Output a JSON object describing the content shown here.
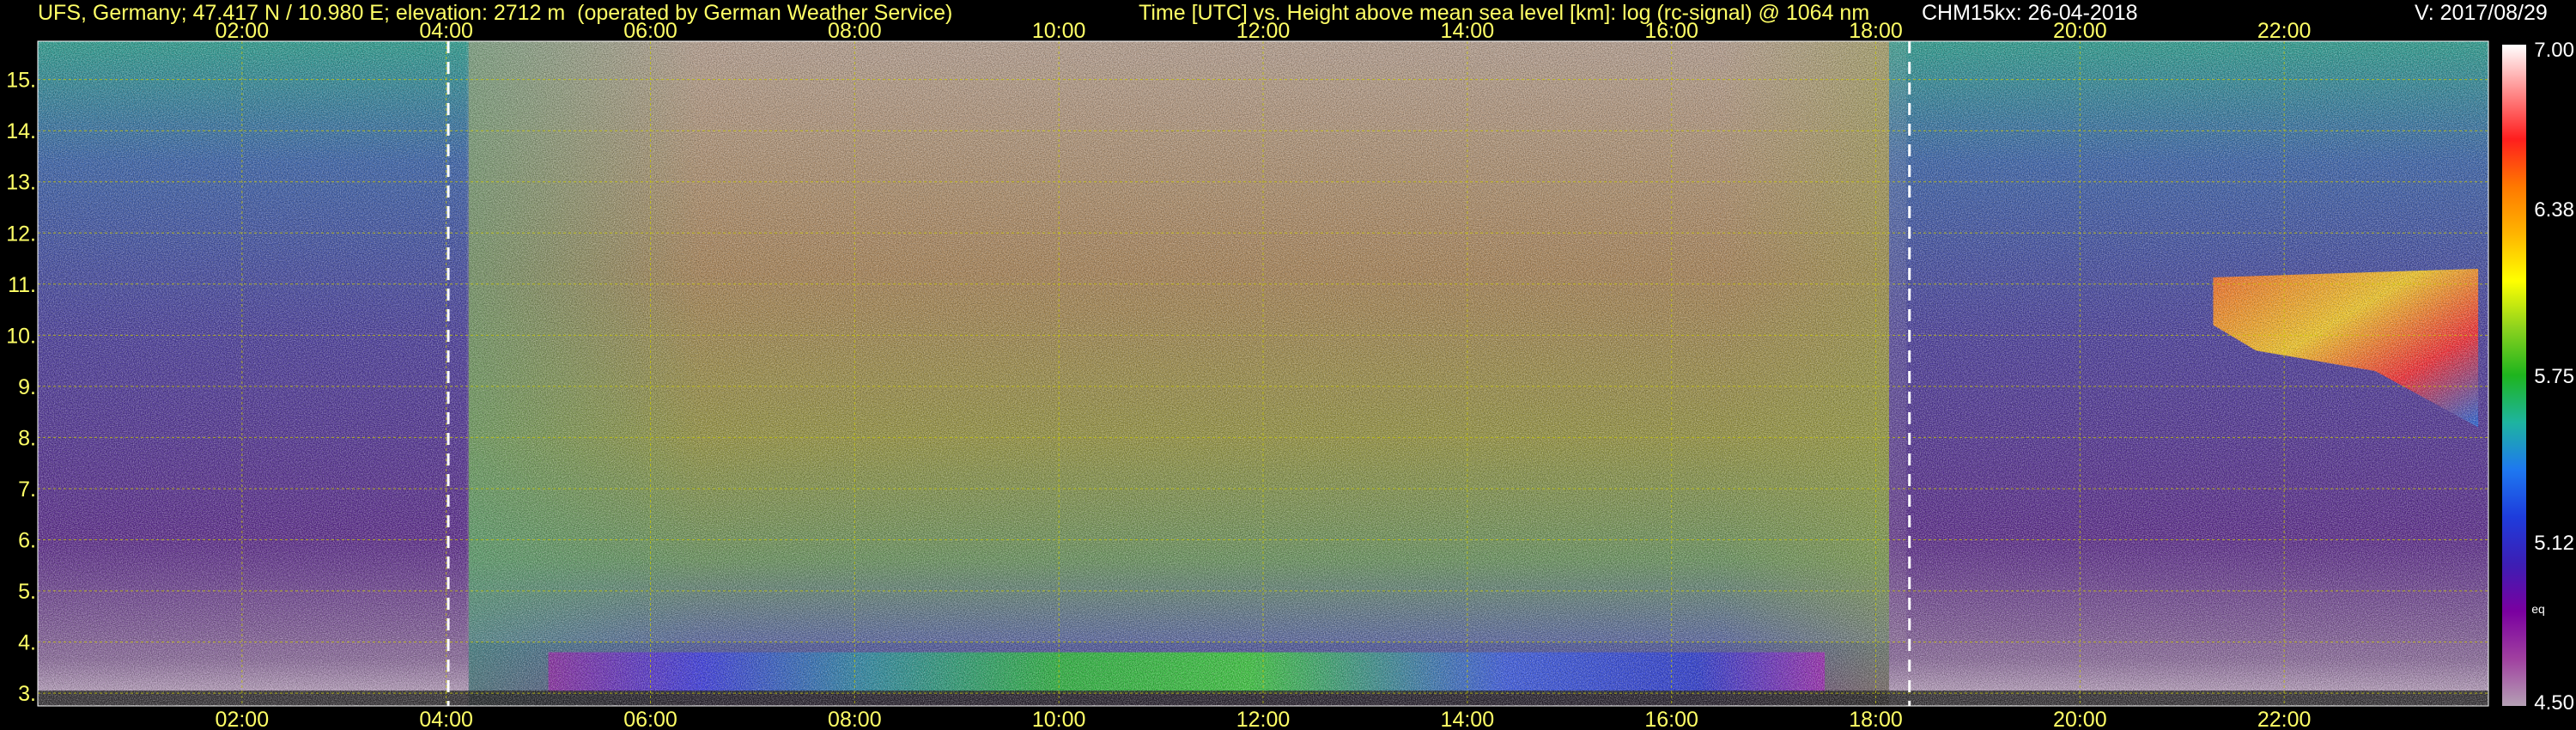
{
  "header": {
    "site": "UFS, Germany; 47.417 N / 10.980 E; elevation: 2712 m  (operated by German Weather Service)",
    "plot_title": "Time [UTC] vs. Height above mean sea level [km]: log (rc-signal) @ 1064 nm",
    "instrument": "CHM15kx: 26-04-2018",
    "version": "V: 2017/08/29"
  },
  "colors": {
    "background": "#000000",
    "label": "#ffff66",
    "grid": "#c8c800",
    "marker_line": "#ffffff"
  },
  "chart_data": {
    "type": "heatmap",
    "title": "Time [UTC] vs. Height above mean sea level [km]: log (rc-signal) @ 1064 nm",
    "xlabel": "Time [UTC]",
    "ylabel": "Height above mean sea level [km]",
    "x_ticks": [
      "02:00",
      "04:00",
      "06:00",
      "08:00",
      "10:00",
      "12:00",
      "14:00",
      "16:00",
      "18:00",
      "20:00",
      "22:00"
    ],
    "x_tick_hours": [
      2,
      4,
      6,
      8,
      10,
      12,
      14,
      16,
      18,
      20,
      22
    ],
    "xlim": [
      0.0,
      24.0
    ],
    "y_ticks": [
      "3.",
      "4.",
      "5.",
      "6.",
      "7.",
      "8.",
      "9.",
      "10.",
      "11.",
      "12.",
      "13.",
      "14.",
      "15."
    ],
    "y_tick_values": [
      3,
      4,
      5,
      6,
      7,
      8,
      9,
      10,
      11,
      12,
      13,
      14,
      15
    ],
    "ylim": [
      2.75,
      15.75
    ],
    "grid": true,
    "sun_lines_hours": [
      4.02,
      18.33
    ],
    "colorbar": {
      "labels": [
        "7.00",
        "6.38",
        "5.75",
        "5.12",
        "4.50"
      ],
      "values": [
        7.0,
        6.38,
        5.75,
        5.12,
        4.5
      ],
      "range": [
        4.5,
        7.0
      ],
      "small_label": "eq",
      "stops": [
        "#b4a0b4",
        "#a040a0",
        "#7a00a0",
        "#3c1eb4",
        "#1e3cdc",
        "#1e78f0",
        "#1eb4a0",
        "#1eb41e",
        "#8cd21e",
        "#ffff00",
        "#ffb400",
        "#ff7800",
        "#ff1e1e",
        "#ff8c8c",
        "#ffffff"
      ]
    },
    "features": [
      {
        "name": "surface boundary layer",
        "t_start": 5.0,
        "t_end": 17.5,
        "h_min": 3.0,
        "h_max": 3.8
      },
      {
        "name": "cirrus cloud",
        "t_start": 20.8,
        "t_end": 23.9,
        "h_min": 8.2,
        "h_max": 11.3
      },
      {
        "name": "high background noise",
        "t_start": 4.2,
        "t_end": 18.3,
        "h_min": 4.0,
        "h_max": 15.75
      }
    ]
  }
}
